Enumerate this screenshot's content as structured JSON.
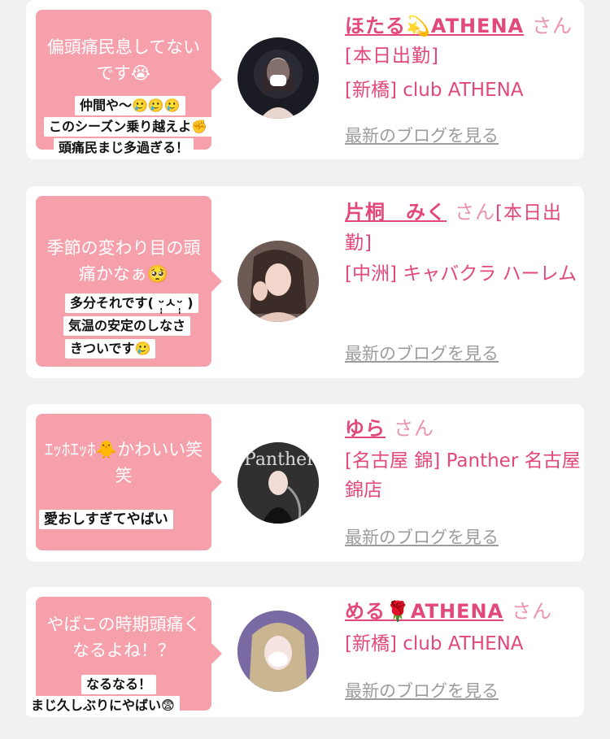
{
  "cards": [
    {
      "bubble_text": "偏頭痛民息してないです😭",
      "stamp_lines": [
        "仲間や〜🥲🥲🥲",
        "このシーズン乗り越えよ✊",
        "頭痛民まじ多過ぎる！"
      ],
      "name": "ほたる💫ATHENA",
      "honorific": "さん",
      "status": "[本日出勤]",
      "location": "[新橋] club ATHENA",
      "blog_link": "最新のブログを見る"
    },
    {
      "bubble_text": "季節の変わり目の頭痛かなぁ🥺",
      "stamp_lines": [
        "多分それです( ᵕ̩̩ㅅᵕ̩̩ )",
        "気温の安定のしなさ",
        "きついです🥲"
      ],
      "name": "片桐　みく",
      "honorific": "さん",
      "status": "[本日出勤]",
      "location": "[中洲] キャバクラ ハーレム",
      "blog_link": "最新のブログを見る"
    },
    {
      "bubble_text": "ｴｯﾎｴｯﾎ🐥かわいい笑笑",
      "stamp_lines": [
        "愛おしすぎてやばい"
      ],
      "name": "ゆら",
      "honorific": "さん",
      "location": "[名古屋 錦] Panther 名古屋錦店",
      "blog_link": "最新のブログを見る",
      "avatar_text": "Panther"
    },
    {
      "bubble_text": "やばこの時期頭痛くなるよね！？",
      "stamp_lines": [
        "なるなる！",
        "まじ久しぶりにやばい😨"
      ],
      "name": "める🌹ATHENA",
      "honorific": "さん",
      "location": "[新橋] club ATHENA",
      "blog_link": "最新のブログを見る"
    }
  ],
  "colors": {
    "background": "#f1f1f1",
    "bubble": "#f6a0ac",
    "name": "#e2487a",
    "link": "#9c9c9c"
  }
}
